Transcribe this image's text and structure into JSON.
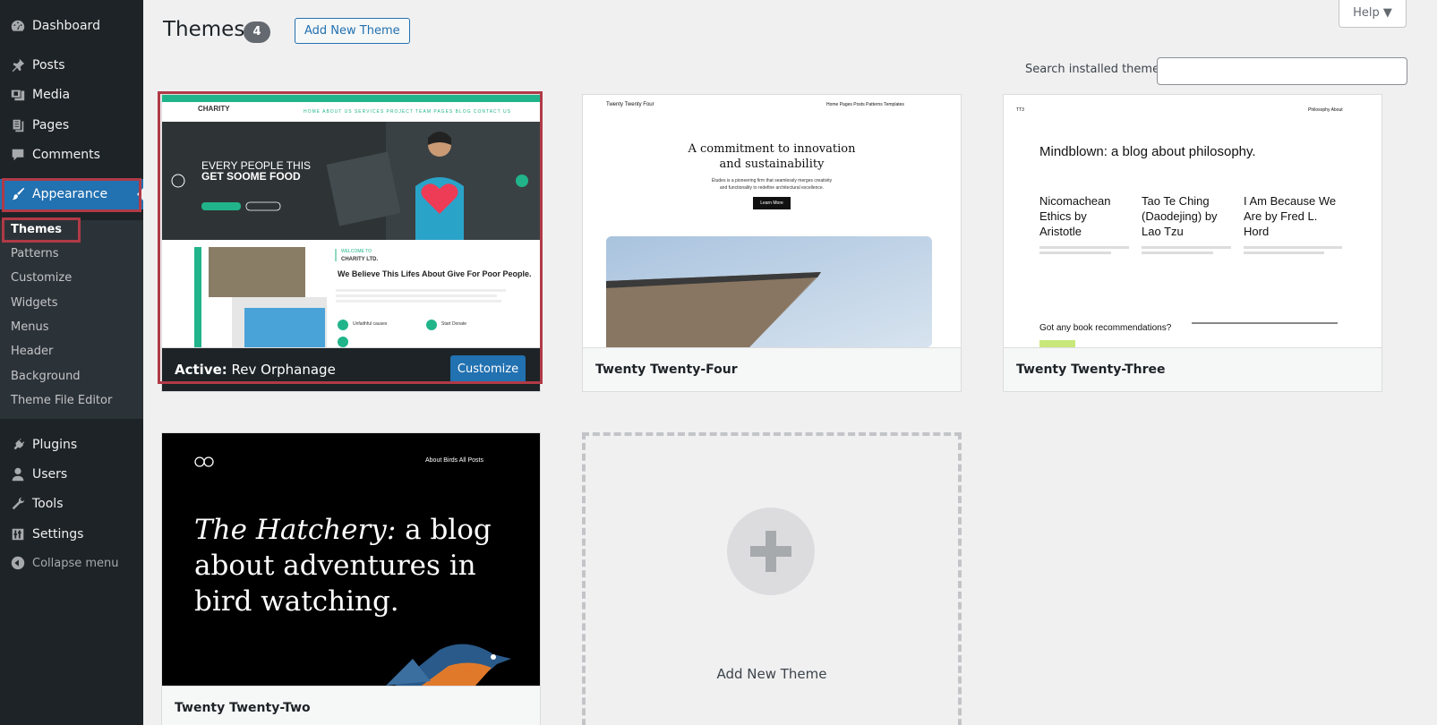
{
  "sidebar": {
    "items": [
      {
        "label": "Dashboard",
        "icon": "dashboard-icon"
      },
      {
        "label": "Posts",
        "icon": "pin-icon"
      },
      {
        "label": "Media",
        "icon": "media-icon"
      },
      {
        "label": "Pages",
        "icon": "pages-icon"
      },
      {
        "label": "Comments",
        "icon": "comment-icon"
      },
      {
        "label": "Appearance",
        "icon": "brush-icon"
      },
      {
        "label": "Plugins",
        "icon": "plug-icon"
      },
      {
        "label": "Users",
        "icon": "user-icon"
      },
      {
        "label": "Tools",
        "icon": "wrench-icon"
      },
      {
        "label": "Settings",
        "icon": "settings-icon"
      },
      {
        "label": "Collapse menu",
        "icon": "collapse-icon"
      }
    ],
    "submenu": [
      "Themes",
      "Patterns",
      "Customize",
      "Widgets",
      "Menus",
      "Header",
      "Background",
      "Theme File Editor"
    ]
  },
  "header": {
    "title": "Themes",
    "count": "4",
    "add_new_label": "Add New Theme",
    "help_label": "Help ▼"
  },
  "search": {
    "label": "Search installed themes",
    "placeholder": "",
    "value": ""
  },
  "themes": [
    {
      "name": "Rev Orphanage",
      "active_label": "Active:",
      "customize_label": "Customize",
      "preview": {
        "logo": "CHARITY",
        "nav": "HOME   ABOUT US   SERVICES   PROJECT   TEAM   PAGES   BLOG   CONTACT US",
        "hero_line1": "EVERY PEOPLE THIS",
        "hero_line2": "GET SOOME FOOD",
        "welcome": "WELCOME TO",
        "company": "CHARITY LTD.",
        "headline": "We Believe This Lifes About Give For Poor People.",
        "item1": "Unfaithful causes",
        "item2": "Start Donate"
      }
    },
    {
      "name": "Twenty Twenty-Four",
      "preview": {
        "site": "Twenty Twenty Four",
        "nav": "Home   Pages   Posts   Patterns   Templates",
        "headline_line1": "A commitment to innovation",
        "headline_line2": "and sustainability",
        "sub1": "Études is a pioneering firm that seamlessly merges creativity",
        "sub2": "and functionality to redefine architectural excellence.",
        "button": "Learn More"
      }
    },
    {
      "name": "Twenty Twenty-Three",
      "preview": {
        "site": "TT3",
        "nav": "Philosophy   About",
        "headline": "Mindblown: a blog about philosophy.",
        "col1": "Nicomachean Ethics by Aristotle",
        "col2": "Tao Te Ching (Daodejing) by Lao Tzu",
        "col3": "I Am Because We Are by Fred L. Hord",
        "footer": "Got any book recommendations?"
      }
    },
    {
      "name": "Twenty Twenty-Two",
      "preview": {
        "nav": "About   Birds   All Posts",
        "title_italic": "The Hatchery:",
        "title_rest1": " a blog",
        "title_rest2": "about adventures in",
        "title_rest3": "bird watching."
      }
    }
  ],
  "add_new_card_label": "Add New Theme",
  "colors": {
    "sidebar_bg": "#1d2327",
    "accent": "#2271b1",
    "highlight": "#b03a46",
    "charity_green": "#21b48a"
  }
}
